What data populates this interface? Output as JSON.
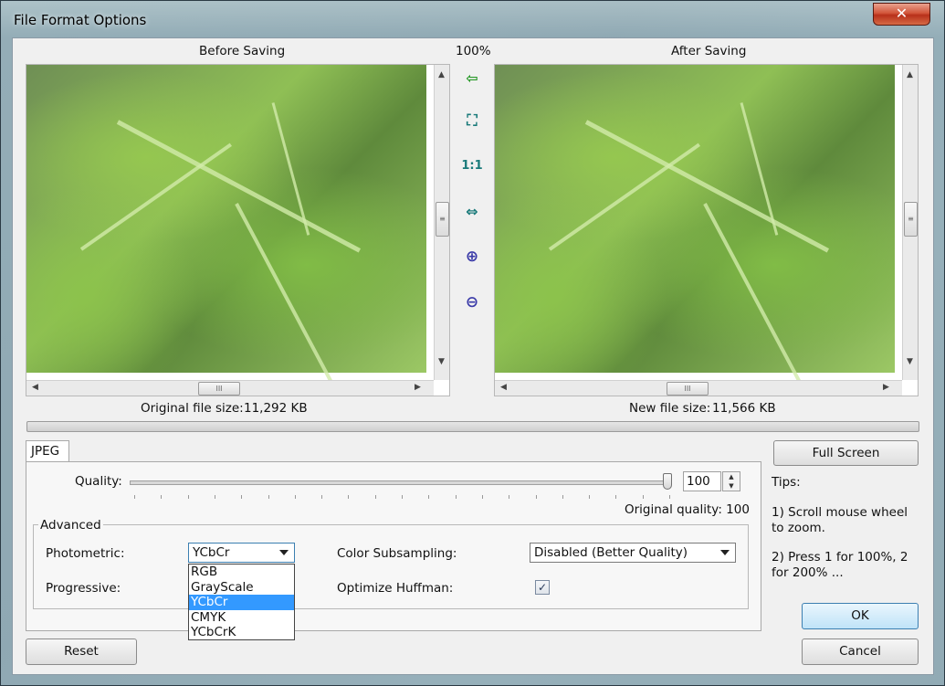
{
  "window": {
    "title": "File Format Options",
    "close_glyph": "✕"
  },
  "preview": {
    "before_label": "Before Saving",
    "after_label": "After Saving",
    "zoom": "100%",
    "original_size_label": "Original file size:",
    "original_size_value": "11,292 KB",
    "new_size_label": "New file size:",
    "new_size_value": "11,566 KB"
  },
  "toolbar": {
    "tools": [
      {
        "icon": "arrow-left-icon",
        "glyph": "⇦"
      },
      {
        "icon": "fit-window-icon",
        "glyph": "⛶"
      },
      {
        "icon": "actual-size-icon",
        "glyph": "1:1"
      },
      {
        "icon": "fit-width-icon",
        "glyph": "⇔"
      },
      {
        "icon": "zoom-in-icon",
        "glyph": "⊕"
      },
      {
        "icon": "zoom-out-icon",
        "glyph": "⊖"
      }
    ]
  },
  "tabs": [
    {
      "label": "JPEG",
      "active": true
    }
  ],
  "jpeg": {
    "quality_label": "Quality:",
    "quality_value": "100",
    "original_quality": "Original quality: 100",
    "advanced_label": "Advanced",
    "photometric_label": "Photometric:",
    "photometric_value": "YCbCr",
    "photometric_options": [
      "RGB",
      "GrayScale",
      "YCbCr",
      "CMYK",
      "YCbCrK"
    ],
    "progressive_label": "Progressive:",
    "subsampling_label": "Color Subsampling:",
    "subsampling_value": "Disabled (Better Quality)",
    "huffman_label": "Optimize Huffman:",
    "huffman_checked": true
  },
  "sidebar": {
    "full_screen": "Full Screen",
    "tips_title": "Tips:",
    "tip1": "1) Scroll mouse wheel to zoom.",
    "tip2": "2) Press 1 for 100%, 2 for 200% ..."
  },
  "buttons": {
    "reset": "Reset",
    "ok": "OK",
    "cancel": "Cancel"
  }
}
